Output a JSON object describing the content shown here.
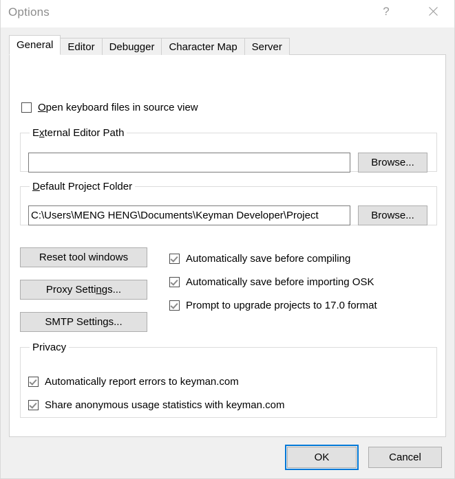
{
  "window": {
    "title": "Options",
    "help_icon": "question-mark-icon",
    "close_icon": "close-x-icon"
  },
  "tabs": [
    {
      "label": "General",
      "active": true
    },
    {
      "label": "Editor",
      "active": false
    },
    {
      "label": "Debugger",
      "active": false
    },
    {
      "label": "Character Map",
      "active": false
    },
    {
      "label": "Server",
      "active": false
    }
  ],
  "general": {
    "open_in_source_view": {
      "label_pre": "",
      "accel": "O",
      "label_post": "pen keyboard files in source view",
      "checked": false
    },
    "external_editor": {
      "title_pre": "E",
      "title_accel": "x",
      "title_post": "ternal Editor Path",
      "value": "",
      "placeholder": "",
      "browse_label": "Browse..."
    },
    "default_project_folder": {
      "title_pre": "",
      "title_accel": "D",
      "title_post": "efault Project Folder",
      "value": "C:\\Users\\MENG HENG\\Documents\\Keyman Developer\\Project",
      "browse_label": "Browse..."
    },
    "buttons": {
      "reset_tool_windows": "Reset tool windows",
      "proxy_settings_pre": "Proxy Setti",
      "proxy_settings_accel": "n",
      "proxy_settings_post": "gs...",
      "smtp_settings": "SMTP Settings..."
    },
    "checkboxes": [
      {
        "label": "Automatically save before compiling",
        "checked": true
      },
      {
        "label": "Automatically save before importing OSK",
        "checked": true
      },
      {
        "label": "Prompt to upgrade projects to 17.0 format",
        "checked": true
      }
    ],
    "privacy": {
      "title": "Privacy",
      "items": [
        {
          "label": "Automatically report errors to keyman.com",
          "checked": true
        },
        {
          "label": "Share anonymous usage statistics with keyman.com",
          "checked": true
        }
      ]
    }
  },
  "footer": {
    "ok_label": "OK",
    "cancel_label": "Cancel"
  },
  "colors": {
    "accent_focus": "#0078d7",
    "dialog_bg": "#f0f0f0",
    "panel_bg": "#ffffff",
    "button_face": "#e1e1e1",
    "title_text": "#8d8d8d"
  }
}
